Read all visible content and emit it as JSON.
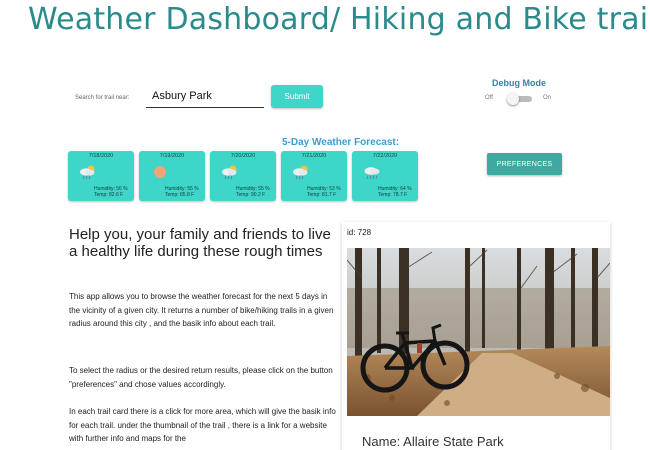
{
  "header": {
    "title": "Weather Dashboard/ Hiking and Bike trails"
  },
  "search": {
    "label": "Search for trail near:",
    "value": "Asbury Park",
    "submit_label": "Submit"
  },
  "debug": {
    "title": "Debug Mode",
    "off_label": "Off",
    "on_label": "On",
    "enabled": false
  },
  "forecast": {
    "title": "5-Day Weather Forecast:",
    "days": [
      {
        "date": "7/18/2020",
        "icon": "cloud-sun-rain-icon",
        "humidity": "Humidity: 56 %",
        "temp": "Temp: 82.6 F"
      },
      {
        "date": "7/19/2020",
        "icon": "sun-icon",
        "humidity": "Humidity: 55 %",
        "temp": "Temp: 85.8 F"
      },
      {
        "date": "7/20/2020",
        "icon": "cloud-sun-rain-icon",
        "humidity": "Humidity: 55 %",
        "temp": "Temp: 90.2 F"
      },
      {
        "date": "7/21/2020",
        "icon": "cloud-sun-rain-icon",
        "humidity": "Humidity: 53 %",
        "temp": "Temp: 81.7 F"
      },
      {
        "date": "7/22/2020",
        "icon": "cloud-rain-icon",
        "humidity": "Humidity: 64 %",
        "temp": "Temp: 78.7 F"
      }
    ]
  },
  "preferences": {
    "label": "PREFERENCES"
  },
  "intro": {
    "heading": "Help you, your family and friends to live a healthy life during these rough times",
    "paragraphs": [
      "This app allows you to browse the weather forecast for the next 5 days in the vicinity of a given city. It returns a number of bike/hiking trails in a given radius around this city , and the basik info about each trail.",
      "To select the radius or the desired return results, please click on the button \"preferences\" and chose values accordingly.",
      "In each trail card there is a click for more area, which will give the basik info for each trail. under the thumbnail of the trail , there is a link for a website with further info and maps for the"
    ]
  },
  "trail_card": {
    "id_text": "id: 728",
    "name_text": "Name: Allaire State Park"
  },
  "colors": {
    "title": "#2a8a8c",
    "accent": "#3dd6c9",
    "preferences": "#3fa99f",
    "forecast_title": "#3aa0d0"
  }
}
